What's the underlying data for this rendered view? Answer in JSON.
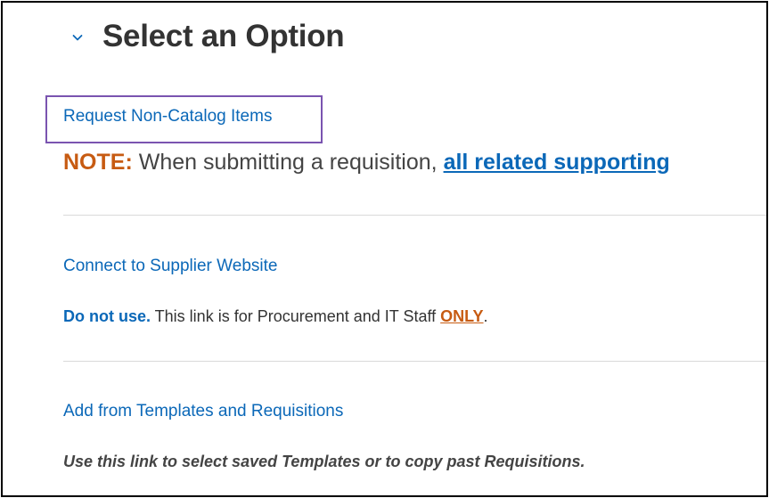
{
  "section": {
    "title": "Select an Option"
  },
  "options": {
    "non_catalog": {
      "link": "Request Non-Catalog Items",
      "note_label": "NOTE:",
      "note_text": " When submitting a requisition, ",
      "note_link": "all related supporting"
    },
    "supplier": {
      "link": "Connect to Supplier Website",
      "desc_strong": "Do not use.",
      "desc_text": " This link is for Procurement and IT Staff ",
      "desc_only": "ONLY",
      "desc_end": "."
    },
    "templates": {
      "link": "Add from Templates and Requisitions",
      "desc": "Use this link to select saved Templates or to copy past Requisitions."
    }
  },
  "colors": {
    "link": "#0b68b8",
    "accent_orange": "#c75b12",
    "focus_outline": "#7a54b0",
    "divider": "#d9d9d9"
  }
}
